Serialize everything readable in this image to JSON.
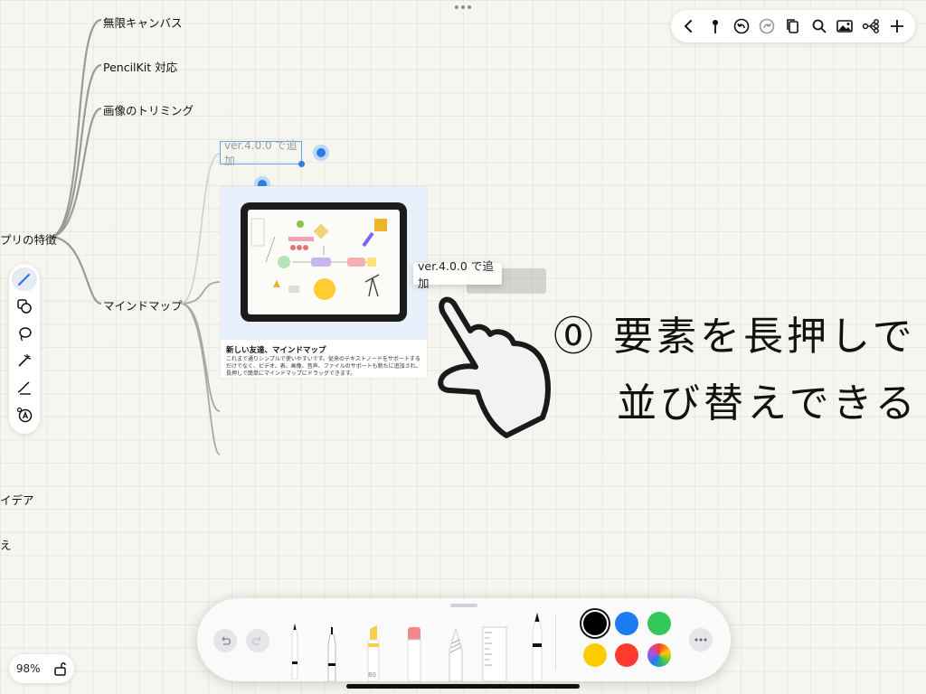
{
  "mindmap": {
    "root_label": "プリの特徴",
    "branches": [
      "無限キャンバス",
      "PencilKit 対応",
      "画像のトリミング",
      "マインドマップ"
    ],
    "left_partials": [
      "イデア",
      "え"
    ],
    "selected_node_text": "ver.4.0.0 で追加",
    "card": {
      "title": "新しい友達、マインドマップ",
      "description": "これまで通りシンプルで使いやすいです。従来のテキストノードをサポートするだけでなく、ビデオ、表、画像、音声、ファイルのサポートも新たに追加され、長押しで簡単にマインドマップにドラッグできます。"
    },
    "drag_ghost_text": "ver.4.0.0 で追加"
  },
  "annotation": {
    "line1": "⓪ 要素を長押しで",
    "line2": "並び替えできる"
  },
  "top_toolbar": {
    "icons": [
      "back-icon",
      "pin-icon",
      "undo-icon",
      "redo-icon",
      "copy-icon",
      "search-icon",
      "image-icon",
      "mindmap-icon",
      "add-icon"
    ]
  },
  "left_tools": {
    "icons": [
      "pen-icon",
      "shapes-icon",
      "lasso-icon",
      "laser-icon",
      "eraser-icon",
      "text-recognition-icon"
    ],
    "active": "pen-icon"
  },
  "zoom": {
    "level": "98%"
  },
  "palette": {
    "marker_label": "80",
    "colors": [
      "#000000",
      "#1e7cf2",
      "#34c759",
      "#ffcc00",
      "#ff3b30"
    ],
    "selected_color": "#000000"
  }
}
